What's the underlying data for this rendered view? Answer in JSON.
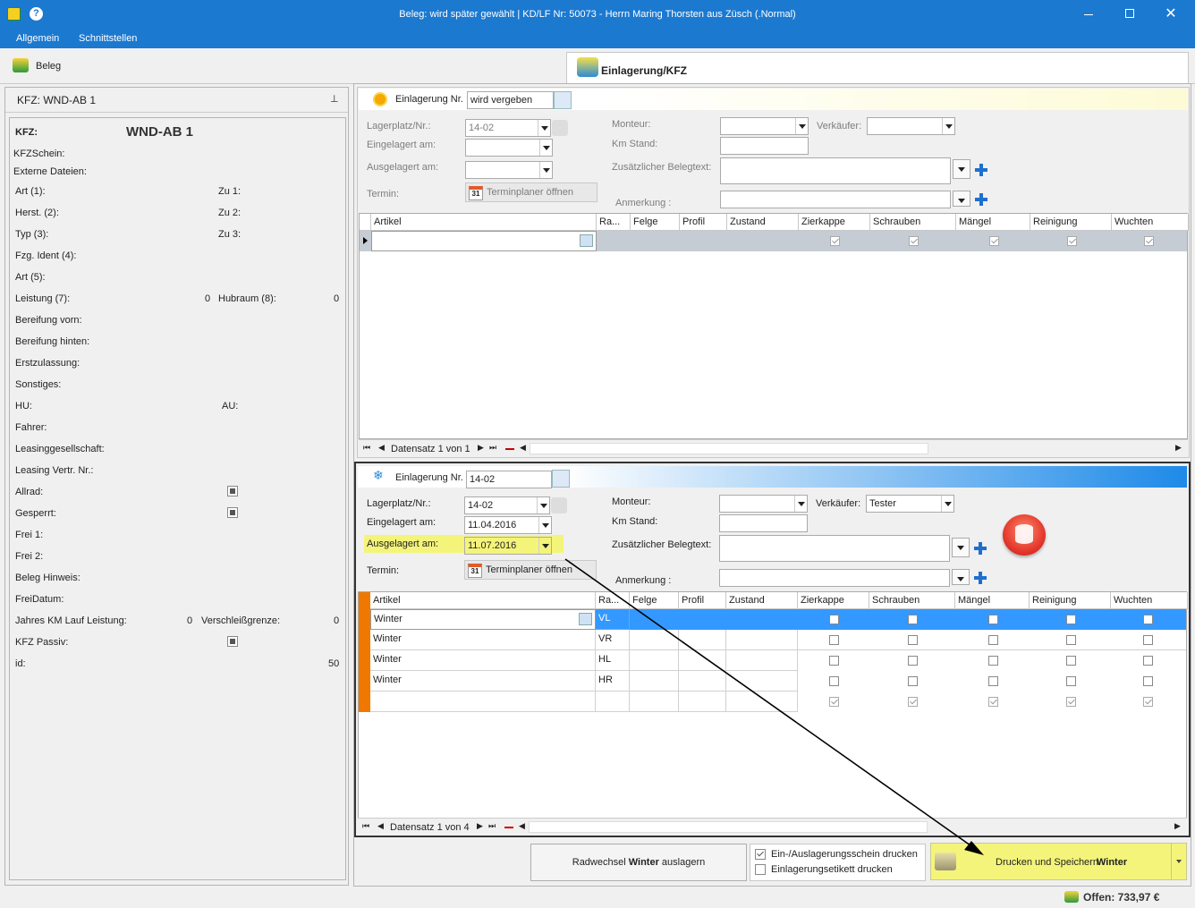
{
  "window": {
    "title": "Beleg: wird später gewählt | KD/LF Nr: 50073 - Herrn Maring Thorsten aus Züsch (.Normal)"
  },
  "menu": {
    "items": [
      "Allgemein",
      "Schnittstellen"
    ]
  },
  "tabs": {
    "beleg": "Beleg",
    "einlagerung": "Einlagerung/KFZ"
  },
  "left": {
    "header": "KFZ: WND-AB 1",
    "kfz_label": "KFZ:",
    "kfz_value": "WND-AB 1",
    "rows": {
      "kfzschein": "KFZSchein:",
      "externe": "Externe Dateien:",
      "art1": "Art (1):",
      "zu1": "Zu 1:",
      "herst2": "Herst. (2):",
      "zu2": "Zu 2:",
      "typ3": "Typ (3):",
      "zu3": "Zu 3:",
      "fzg4": "Fzg. Ident (4):",
      "art5": "Art (5):",
      "leistung": "Leistung (7):",
      "leistung_val": "0",
      "hubraum": "Hubraum (8):",
      "hubraum_val": "0",
      "bereif_vorn": "Bereifung vorn:",
      "bereif_hinten": "Bereifung hinten:",
      "erstzul": "Erstzulassung:",
      "sonstiges": "Sonstiges:",
      "hu": "HU:",
      "au": "AU:",
      "fahrer": "Fahrer:",
      "leasing": "Leasinggesellschaft:",
      "leasing_nr": "Leasing Vertr. Nr.:",
      "allrad": "Allrad:",
      "gesperrt": "Gesperrt:",
      "frei1": "Frei 1:",
      "frei2": "Frei 2:",
      "beleg_hinweis": "Beleg Hinweis:",
      "freidatum": "FreiDatum:",
      "jahres_km": "Jahres KM Lauf Leistung:",
      "jahres_km_val": "0",
      "verschleiss": "Verschleißgrenze:",
      "verschleiss_val": "0",
      "kfz_passiv": "KFZ Passiv:",
      "id": "id:",
      "id_val": "50"
    }
  },
  "top_section": {
    "einlagerung_label": "Einlagerung Nr.",
    "einlagerung_value": "wird vergeben",
    "lagerplatz_label": "Lagerplatz/Nr.:",
    "lagerplatz_value": "14-02",
    "eingelagert_label": "Eingelagert am:",
    "eingelagert_value": "",
    "ausgelagert_label": "Ausgelagert am:",
    "ausgelagert_value": "",
    "termin_label": "Termin:",
    "termin_button": "Terminplaner öffnen",
    "monteur_label": "Monteur:",
    "verkaeufer_label": "Verkäufer:",
    "verkaeufer_value": "",
    "km_label": "Km Stand:",
    "belegtext_label": "Zusätzlicher Belegtext:",
    "anmerkung_label": "Anmerkung :",
    "nav_text": "Datensatz 1 von 1"
  },
  "grid_headers": [
    "Artikel",
    "Ra...",
    "Felge",
    "Profil",
    "Zustand",
    "Zierkappe",
    "Schrauben",
    "Mängel",
    "Reinigung",
    "Wuchten"
  ],
  "bottom_section": {
    "einlagerung_label": "Einlagerung Nr.",
    "einlagerung_value": "14-02",
    "lagerplatz_label": "Lagerplatz/Nr.:",
    "lagerplatz_value": "14-02",
    "eingelagert_label": "Eingelagert am:",
    "eingelagert_value": "11.04.2016",
    "ausgelagert_label": "Ausgelagert am:",
    "ausgelagert_value": "11.07.2016",
    "termin_label": "Termin:",
    "termin_button": "Terminplaner öffnen",
    "monteur_label": "Monteur:",
    "verkaeufer_label": "Verkäufer:",
    "verkaeufer_value": "Tester",
    "km_label": "Km Stand:",
    "belegtext_label": "Zusätzlicher Belegtext:",
    "anmerkung_label": "Anmerkung :",
    "nav_text": "Datensatz 1 von 4",
    "rows": [
      {
        "artikel": "Winter",
        "rad": "VL"
      },
      {
        "artikel": "Winter",
        "rad": "VR"
      },
      {
        "artikel": "Winter",
        "rad": "HL"
      },
      {
        "artikel": "Winter",
        "rad": "HR"
      }
    ]
  },
  "footer": {
    "radwechsel_pre": "Radwechsel ",
    "radwechsel_bold": "Winter",
    "radwechsel_post": " auslagern",
    "check1": "Ein-/Auslagerungsschein drucken",
    "check2": "Einlagerungsetikett drucken",
    "drucken_pre": "Drucken und Speichern ",
    "drucken_bold": "Winter",
    "offen": "Offen: 733,97 €"
  },
  "colors": {
    "titlebar": "#1c79d0",
    "highlight": "#f4f47a",
    "selected_row": "#3398ff",
    "accent_orange": "#f07800"
  }
}
